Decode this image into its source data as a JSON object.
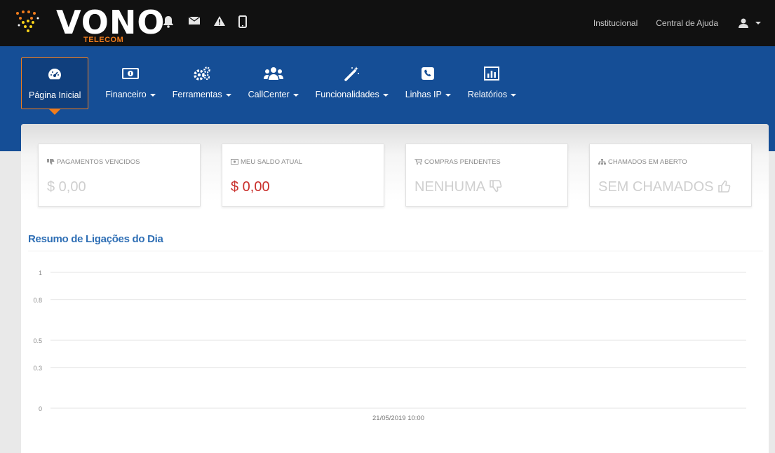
{
  "brand": {
    "name": "VONO",
    "subtitle": "TELECOM"
  },
  "top_links": [
    "Institucional",
    "Central de Ajuda"
  ],
  "nav": [
    {
      "label": "Página Inicial",
      "icon": "dashboard-icon",
      "active": true,
      "dropdown": false
    },
    {
      "label": "Financeiro",
      "icon": "money-icon",
      "active": false,
      "dropdown": true
    },
    {
      "label": "Ferramentas",
      "icon": "gears-icon",
      "active": false,
      "dropdown": true
    },
    {
      "label": "CallCenter",
      "icon": "users-icon",
      "active": false,
      "dropdown": true
    },
    {
      "label": "Funcionalidades",
      "icon": "magic-wand-icon",
      "active": false,
      "dropdown": true
    },
    {
      "label": "Linhas IP",
      "icon": "phone-icon",
      "active": false,
      "dropdown": true
    },
    {
      "label": "Relatórios",
      "icon": "bar-chart-icon",
      "active": false,
      "dropdown": true
    }
  ],
  "cards": [
    {
      "title": "PAGAMENTOS VENCIDOS",
      "value": "$ 0,00",
      "icon": "thumbs-down-small-icon"
    },
    {
      "title": "MEU SALDO ATUAL",
      "value": "$ 0,00",
      "icon": "money-small-icon"
    },
    {
      "title": "COMPRAS PENDENTES",
      "value": "NENHUMA",
      "icon": "cart-icon",
      "value_icon": "thumbs-down-icon"
    },
    {
      "title": "CHAMADOS EM ABERTO",
      "value": "SEM CHAMADOS",
      "icon": "sitemap-icon",
      "value_icon": "thumbs-up-icon"
    }
  ],
  "section": {
    "title": "Resumo de Ligações do Dia"
  },
  "colors": {
    "topbar": "#111111",
    "nav": "#154e96",
    "accent": "#f07c1c",
    "link": "#2f6fb5",
    "negative": "#c9302c"
  },
  "chart_data": {
    "type": "line",
    "x": [
      "21/05/2019 10:00"
    ],
    "series": [],
    "y_ticks": [
      "1",
      "0.8",
      "0.5",
      "0.3",
      "0"
    ],
    "ylim": [
      0,
      1
    ],
    "grid": true
  }
}
